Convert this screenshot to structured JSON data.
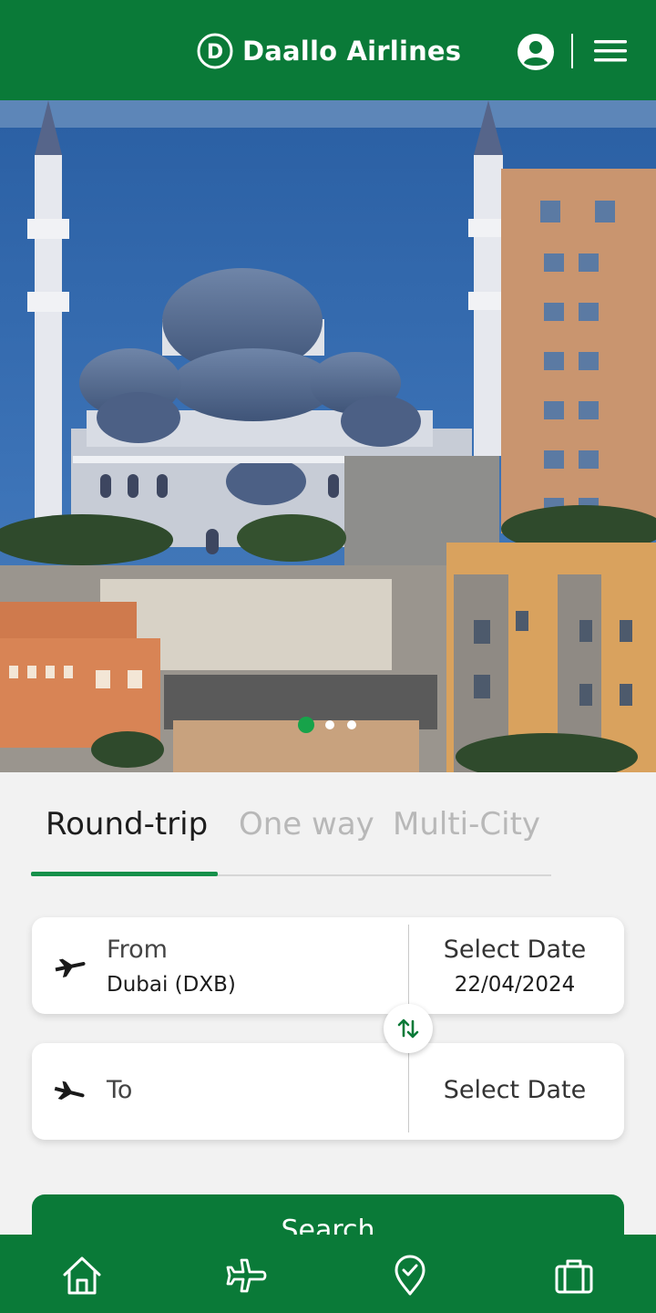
{
  "header": {
    "brand_name": "Daallo Airlines",
    "logo_letter": "D",
    "icons": {
      "account": "account-circle-icon",
      "menu": "hamburger-menu-icon"
    }
  },
  "hero": {
    "slides_total": 3,
    "active_slide": 1
  },
  "trip_tabs": [
    {
      "label": "Round-trip",
      "active": true
    },
    {
      "label": "One way",
      "active": false
    },
    {
      "label": "Multi-City",
      "active": false
    }
  ],
  "from_field": {
    "label": "From",
    "value": "Dubai (DXB)",
    "icon": "takeoff-plane-icon",
    "date_label": "Select Date",
    "date_value": "22/04/2024"
  },
  "to_field": {
    "label": "To",
    "value": "",
    "icon": "landing-plane-icon",
    "date_label": "Select Date",
    "date_value": ""
  },
  "swap": {
    "icon": "swap-arrows-icon"
  },
  "search": {
    "label": "Search"
  },
  "bottom_nav": [
    {
      "icon": "home-icon"
    },
    {
      "icon": "flight-icon"
    },
    {
      "icon": "location-check-icon"
    },
    {
      "icon": "briefcase-icon"
    }
  ],
  "colors": {
    "primary": "#0a7a38",
    "active_tab_indicator": "#16904a",
    "active_dot": "#17a34a",
    "background": "#f2f2f2"
  }
}
